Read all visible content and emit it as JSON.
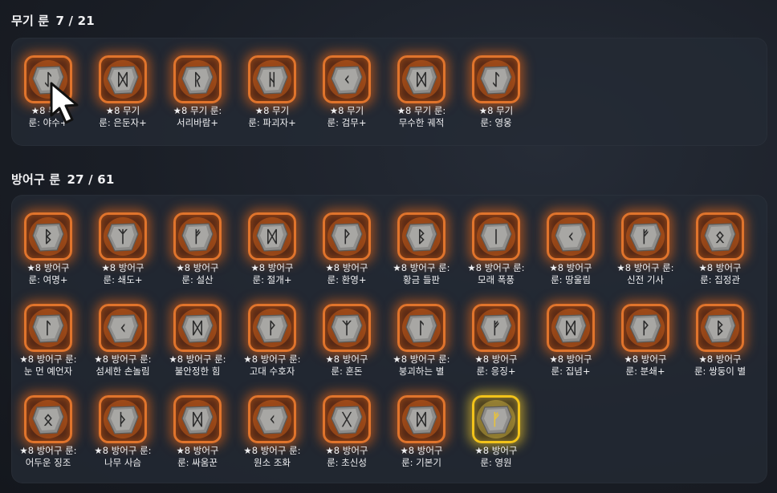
{
  "weapon": {
    "title": "무기 룬",
    "count": "7 / 21",
    "runes": [
      {
        "line1": "★8 무기",
        "line2": "룬: 야수+",
        "glyph": "ᛇ"
      },
      {
        "line1": "★8 무기",
        "line2": "룬: 은둔자+",
        "glyph": "ᛞ"
      },
      {
        "line1": "★8 무기 룬:",
        "line2": "서리바람+",
        "glyph": "ᚱ"
      },
      {
        "line1": "★8 무기",
        "line2": "룬: 파괴자+",
        "glyph": "ᚺ"
      },
      {
        "line1": "★8 무기",
        "line2": "룬: 검무+",
        "glyph": "ᚲ"
      },
      {
        "line1": "★8 무기 룬:",
        "line2": "무수한 궤적",
        "glyph": "ᛞ"
      },
      {
        "line1": "★8 무기",
        "line2": "룬: 영웅",
        "glyph": "ᛇ"
      }
    ]
  },
  "armor": {
    "title": "방어구 룬",
    "count": "27 / 61",
    "runes": [
      {
        "line1": "★8 방어구",
        "line2": "룬: 여명+",
        "glyph": "ᛒ"
      },
      {
        "line1": "★8 방어구",
        "line2": "룬: 쇄도+",
        "glyph": "ᛉ"
      },
      {
        "line1": "★8 방어구",
        "line2": "룬: 설산",
        "glyph": "ᚠ"
      },
      {
        "line1": "★8 방어구",
        "line2": "룬: 절개+",
        "glyph": "ᛞ"
      },
      {
        "line1": "★8 방어구",
        "line2": "룬: 환영+",
        "glyph": "ᚹ"
      },
      {
        "line1": "★8 방어구 룬:",
        "line2": "황금 들판",
        "glyph": "ᛒ"
      },
      {
        "line1": "★8 방어구 룬:",
        "line2": "모래 폭풍",
        "glyph": "ᛁ"
      },
      {
        "line1": "★8 방어구",
        "line2": "룬: 땅울림",
        "glyph": "ᚲ"
      },
      {
        "line1": "★8 방어구 룬:",
        "line2": "신전 기사",
        "glyph": "ᚠ"
      },
      {
        "line1": "★8 방어구",
        "line2": "룬: 집정관",
        "glyph": "ᛟ"
      },
      {
        "line1": "★8 방어구 룬:",
        "line2": "눈 먼 예언자",
        "glyph": "ᛚ"
      },
      {
        "line1": "★8 방어구 룬:",
        "line2": "섬세한 손놀림",
        "glyph": "ᚲ"
      },
      {
        "line1": "★8 방어구 룬:",
        "line2": "불안정한 힘",
        "glyph": "ᛞ"
      },
      {
        "line1": "★8 방어구 룬:",
        "line2": "고대 수호자",
        "glyph": "ᚹ"
      },
      {
        "line1": "★8 방어구",
        "line2": "룬: 혼돈",
        "glyph": "ᛉ"
      },
      {
        "line1": "★8 방어구 룬:",
        "line2": "붕괴하는 별",
        "glyph": "ᛚ"
      },
      {
        "line1": "★8 방어구",
        "line2": "룬: 응징+",
        "glyph": "ᚠ"
      },
      {
        "line1": "★8 방어구",
        "line2": "룬: 집념+",
        "glyph": "ᛞ"
      },
      {
        "line1": "★8 방어구",
        "line2": "룬: 분쇄+",
        "glyph": "ᚹ"
      },
      {
        "line1": "★8 방어구",
        "line2": "룬: 쌍둥이 별",
        "glyph": "ᛒ"
      },
      {
        "line1": "★8 방어구 룬:",
        "line2": "어두운 징조",
        "glyph": "ᛟ"
      },
      {
        "line1": "★8 방어구 룬:",
        "line2": "나무 사슴",
        "glyph": "ᚦ"
      },
      {
        "line1": "★8 방어구",
        "line2": "룬: 싸움꾼",
        "glyph": "ᛞ"
      },
      {
        "line1": "★8 방어구 룬:",
        "line2": "원소 조화",
        "glyph": "ᚲ"
      },
      {
        "line1": "★8 방어구",
        "line2": "룬: 초신성",
        "glyph": "ᚷ"
      },
      {
        "line1": "★8 방어구",
        "line2": "룬: 기본기",
        "glyph": "ᛞ"
      },
      {
        "line1": "★8 방어구",
        "line2": "룬: 영원",
        "glyph": "ᚠ",
        "legendary": true
      }
    ]
  },
  "colors": {
    "rune_border": "#e0742c",
    "legendary_border": "#f2c31a",
    "star": "#f6c21c"
  }
}
